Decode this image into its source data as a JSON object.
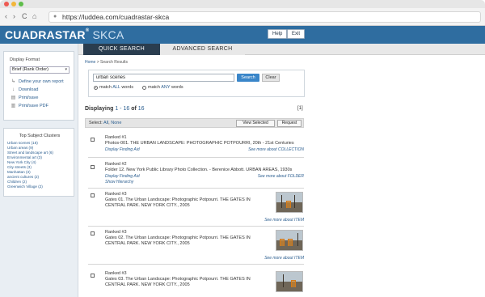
{
  "browser": {
    "url": "https://luddea.com/cuadrastar-skca",
    "nav": {
      "back": "‹",
      "forward": "›",
      "reload": "C",
      "home": "⌂"
    }
  },
  "header": {
    "brand_main": "CUADRASTAR",
    "brand_mark": "®",
    "brand_sub": " SKCA",
    "help_label": "Help",
    "exit_label": "Exit",
    "color": "#2f6da0"
  },
  "tabs": [
    {
      "label": "QUICK SEARCH"
    },
    {
      "label": "ADVANCED SEARCH"
    }
  ],
  "sidebar": {
    "display_format_label": "Display Format",
    "display_format_value": "Brief (Rank Order)",
    "links": [
      {
        "label": "Define your own report",
        "icon": "report-icon"
      },
      {
        "label": "Download",
        "icon": "download-icon"
      },
      {
        "label": "Print/save",
        "icon": "print-icon"
      },
      {
        "label": "Print/save PDF",
        "icon": "pdf-icon"
      }
    ],
    "clusters_title": "Top Subject Clusters",
    "clusters": [
      "Urban scenes (16)",
      "Urban areas (9)",
      "Street and landscape art (6)",
      "Environmental art (3)",
      "New York City (4)",
      "City streets (3)",
      "Manhattan (3)",
      "ancient cultures (2)",
      "Children (2)",
      "Greenwich Village (2)"
    ]
  },
  "main": {
    "breadcrumb_home": "Home",
    "breadcrumb_rest": " > Search Results",
    "search_value": "urban scenes",
    "search_button": "Search",
    "clear_button": "Clear",
    "match_all_prefix": "match ",
    "match_all_kw": "ALL",
    "match_all_suffix": " words",
    "match_any_prefix": "match ",
    "match_any_kw": "ANY",
    "match_any_suffix": " words",
    "displaying_label": "Displaying ",
    "displaying_range": "1 - 16",
    "displaying_of": " of ",
    "displaying_total": "16",
    "page_indicator": "[1]",
    "select_label": "Select: ",
    "select_all": "All",
    "select_sep": ", ",
    "select_none": "None",
    "view_selected": "View Selected",
    "request": "Request"
  },
  "results": [
    {
      "rank": "Ranked #1",
      "title": "Photos-001. THE URBAN LANDSCAPE: PHOTOGRAPHIC POTPOURRI, 20th - 21st Centuries",
      "aid": "Display Finding Aid",
      "hierarchy": "",
      "more": "See more about COLLECTION"
    },
    {
      "rank": "Ranked #2",
      "title": "Folder 12. New York Public Library Photo Collection. - Berenice Abbott. URBAN AREAS, 1930s",
      "aid": "Display Finding Aid",
      "hierarchy": "Show Hierarchy",
      "more": "See more about FOLDER"
    },
    {
      "rank": "Ranked #3",
      "title": "Gates 01. The Urban Landscape: Photographic Potpourri. THE GATES IN CENTRAL PARK. NEW YORK CITY., 2005",
      "more": "See more about ITEM"
    },
    {
      "rank": "Ranked #3",
      "title": "Gates 02. The Urban Landscape: Photographic Potpourri. THE GATES IN CENTRAL PARK. NEW YORK CITY., 2005",
      "more": "See more about ITEM"
    },
    {
      "rank": "Ranked #3",
      "title": "Gates 03. The Urban Landscape: Photographic Potpourri. THE GATES IN CENTRAL PARK. NEW YORK CITY., 2005",
      "more": ""
    }
  ]
}
